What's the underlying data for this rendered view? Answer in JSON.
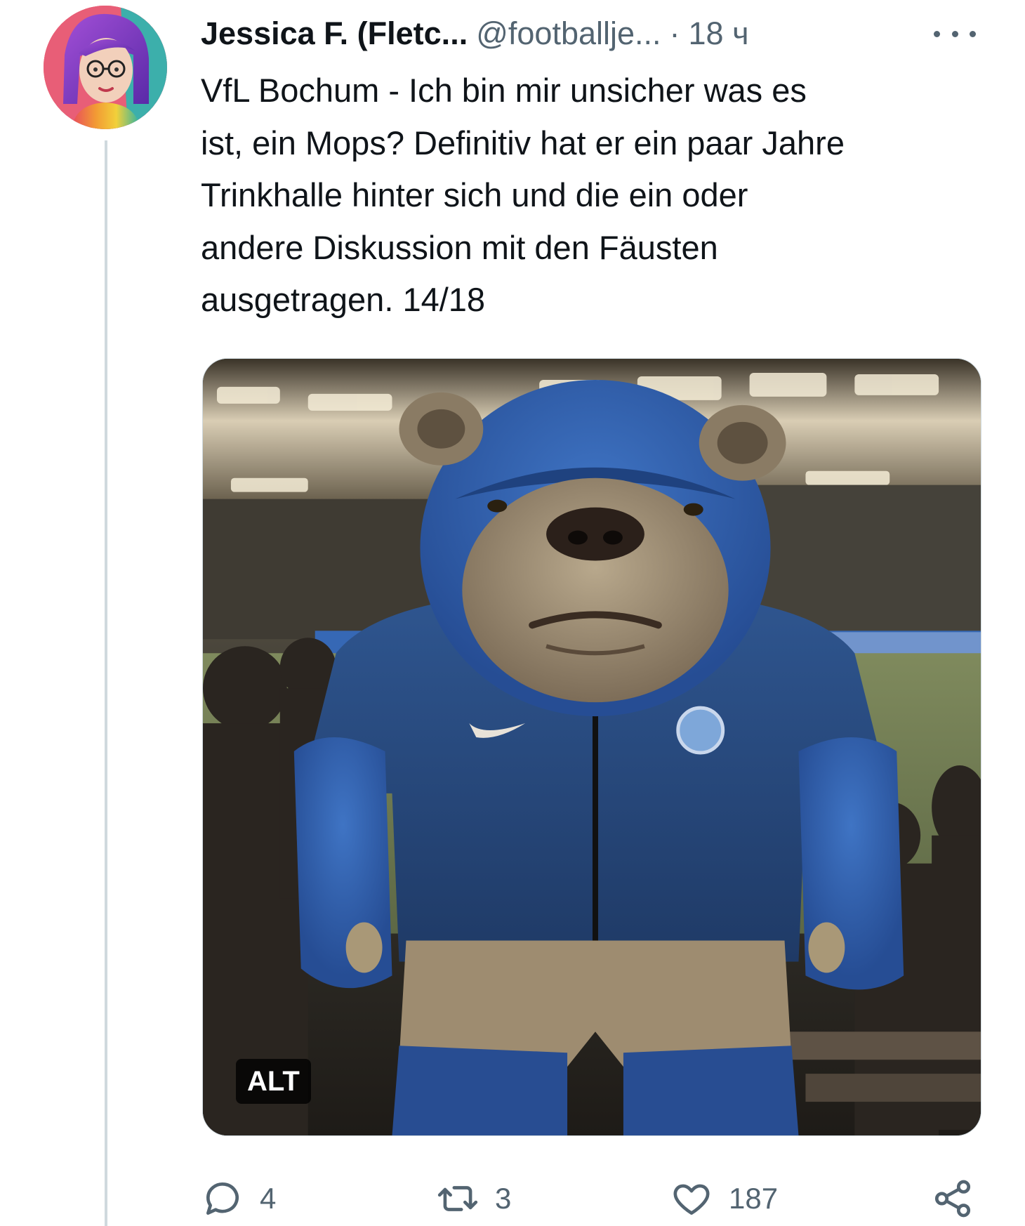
{
  "author": {
    "name": "Jessica F. (Fletc...",
    "handle": "@footballje...",
    "separator": "·",
    "time": "18 ч"
  },
  "tweet": {
    "text": "VfL Bochum - Ich bin mir unsicher was es\nist, ein Mops? Definitiv hat er ein paar Jahre\nTrinkhalle hinter sich und die ein oder\nandere Diskussion mit den Fäusten\nausgetragen. 14/18"
  },
  "media": {
    "alt_label": "ALT"
  },
  "actions": {
    "replies": "4",
    "retweets": "3",
    "likes": "187"
  },
  "icons": {
    "more": "more-horizontal-icon",
    "reply": "reply-bubble-icon",
    "retweet": "retweet-arrows-icon",
    "like": "heart-icon",
    "share": "share-nodes-icon"
  },
  "colors": {
    "text_primary": "#0f1419",
    "text_secondary": "#536471",
    "thread_line": "#cfd9de"
  }
}
